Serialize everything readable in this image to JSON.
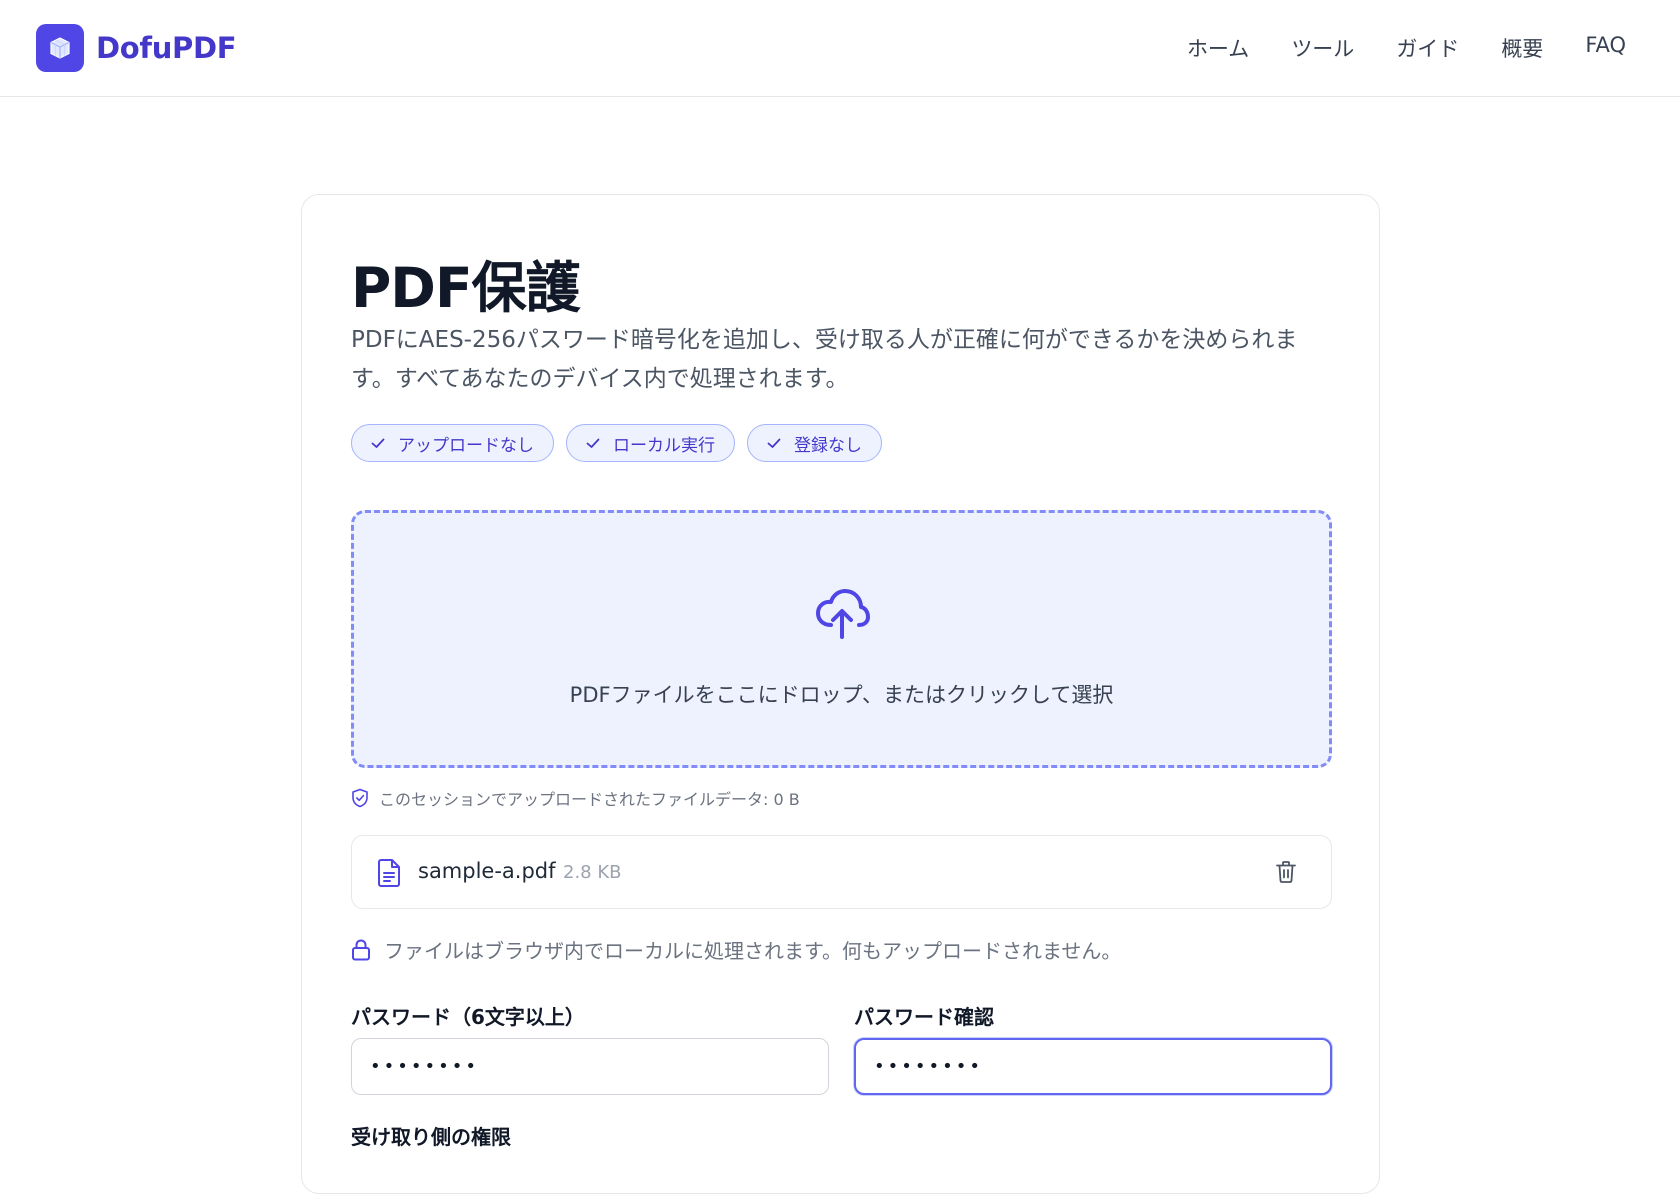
{
  "brand": {
    "name": "DofuPDF",
    "logo_icon": "cube-icon",
    "color": "#4f46e5"
  },
  "nav": {
    "items": [
      {
        "label": "ホーム"
      },
      {
        "label": "ツール"
      },
      {
        "label": "ガイド"
      },
      {
        "label": "概要"
      },
      {
        "label": "FAQ"
      }
    ]
  },
  "main": {
    "title": "PDF保護",
    "subtitle": "PDFにAES-256パスワード暗号化を追加し、受け取る人が正確に何ができるかを決められます。すべてあなたのデバイス内で処理されます。",
    "badges": [
      {
        "label": "アップロードなし",
        "icon": "check-icon"
      },
      {
        "label": "ローカル実行",
        "icon": "check-icon"
      },
      {
        "label": "登録なし",
        "icon": "check-icon"
      }
    ],
    "dropzone": {
      "text": "PDFファイルをここにドロップ、またはクリックして選択",
      "icon": "cloud-upload-icon"
    },
    "session_note": "このセッションでアップロードされたファイルデータ: 0 B",
    "file": {
      "name": "sample-a.pdf",
      "size": "2.8 KB"
    },
    "local_note": "ファイルはブラウザ内でローカルに処理されます。何もアップロードされません。",
    "password": {
      "label": "パスワード（6文字以上）",
      "value": "••••••••"
    },
    "password_confirm": {
      "label": "パスワード確認",
      "value": "••••••••"
    },
    "permissions_label": "受け取り側の権限"
  },
  "colors": {
    "accent": "#4f46e5",
    "accent_light": "#eef2ff",
    "border": "#e5e7eb"
  }
}
